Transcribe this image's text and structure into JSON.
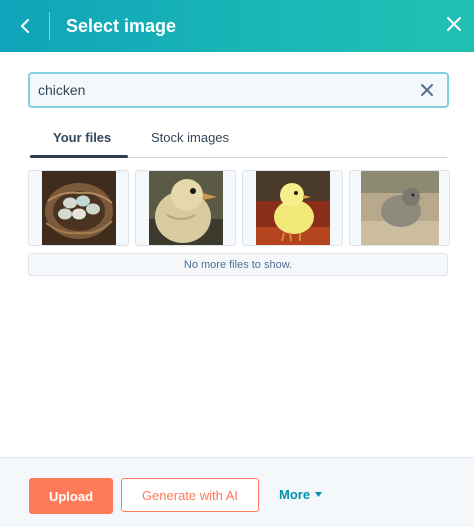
{
  "header": {
    "title": "Select image",
    "back_icon": "chevron-left-icon",
    "close_icon": "close-icon"
  },
  "search": {
    "value": "chicken",
    "clear_icon": "close-icon"
  },
  "tabs": [
    {
      "label": "Your files",
      "active": true
    },
    {
      "label": "Stock images",
      "active": false
    }
  ],
  "results": {
    "thumbnails": [
      {
        "subject": "eggs-in-nest"
      },
      {
        "subject": "chick-closeup"
      },
      {
        "subject": "yellow-chick-painting"
      },
      {
        "subject": "fluffy-gray-chick"
      }
    ],
    "empty_message": "No more files to show."
  },
  "footer": {
    "upload_label": "Upload",
    "generate_label": "Generate with AI",
    "more_label": "More"
  },
  "colors": {
    "header": "#1bb8b6",
    "accent": "#ff7a59",
    "link": "#0091ae",
    "text": "#33475b"
  }
}
